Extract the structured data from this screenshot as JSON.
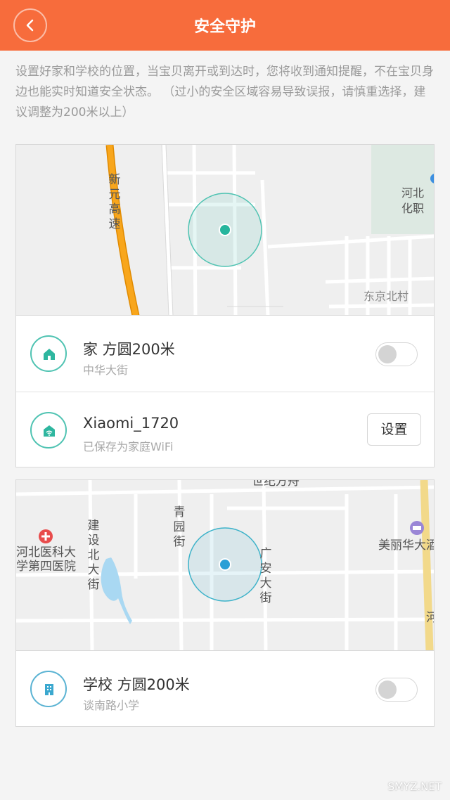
{
  "header": {
    "title": "安全守护",
    "back_icon": "chevron-left-icon"
  },
  "intro": "设置好家和学校的位置，当宝贝离开或到达时，您将收到通知提醒，不在宝贝身边也能实时知道安全状态。 （过小的安全区域容易导致误报，请慎重选择，建议调整为200米以上）",
  "home_map": {
    "labels": {
      "highway": "新元高速",
      "school_name": "河北化职业技",
      "village": "东京北村"
    },
    "zone_color": "#4fc3b2"
  },
  "home": {
    "icon": "home-icon",
    "title": "家 方圆200米",
    "subtitle": "中华大街",
    "toggle_on": false
  },
  "wifi": {
    "icon": "wifi-icon",
    "title": "Xiaomi_1720",
    "subtitle": "已保存为家庭WiFi",
    "button_label": "设置"
  },
  "school_map": {
    "labels": {
      "top_cut": "世纪方舟",
      "hospital": "河北医科大学第四医院",
      "road_jianshe": "建设北大街",
      "road_qingyuan": "青园街",
      "road_guangan": "广安大街",
      "hotel": "美丽华大酒",
      "edge_right": "河"
    },
    "zone_color": "#5ab3d3"
  },
  "school": {
    "icon": "building-icon",
    "title": "学校 方圆200米",
    "subtitle": "谈南路小学",
    "toggle_on": false
  },
  "watermark": "SMYZ.NET"
}
